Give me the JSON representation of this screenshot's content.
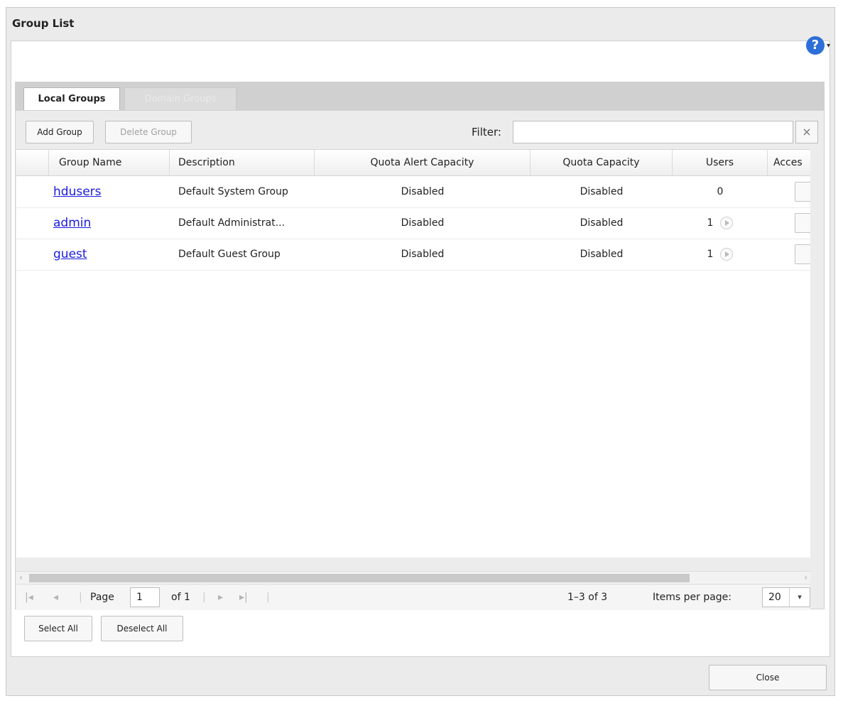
{
  "window": {
    "title": "Group List"
  },
  "help": {
    "icon": "help-icon",
    "glyph": "?",
    "caret": "▾"
  },
  "tabs": [
    {
      "label": "Local Groups",
      "active": true
    },
    {
      "label": "Domain Groups",
      "active": false
    }
  ],
  "toolbar": {
    "add_label": "Add Group",
    "delete_label": "Delete Group",
    "filter_label": "Filter:",
    "filter_value": "",
    "clear_glyph": "×"
  },
  "table": {
    "columns": [
      "Group Name",
      "Description",
      "Quota Alert Capacity",
      "Quota Capacity",
      "Users",
      "Acces"
    ],
    "rows": [
      {
        "name": "hdusers",
        "description": "Default System Group",
        "quota_alert": "Disabled",
        "quota": "Disabled",
        "users": "0",
        "has_user_arrow": false
      },
      {
        "name": "admin",
        "description": "Default Administrat...",
        "quota_alert": "Disabled",
        "quota": "Disabled",
        "users": "1",
        "has_user_arrow": true
      },
      {
        "name": "guest",
        "description": "Default Guest Group",
        "quota_alert": "Disabled",
        "quota": "Disabled",
        "users": "1",
        "has_user_arrow": true
      }
    ]
  },
  "pager": {
    "page_label": "Page",
    "page_value": "1",
    "of_label": "of 1",
    "range": "1–3 of 3",
    "items_per_page_label": "Items per page:",
    "items_per_page_value": "20"
  },
  "footer": {
    "select_all": "Select All",
    "deselect_all": "Deselect All",
    "close": "Close"
  }
}
